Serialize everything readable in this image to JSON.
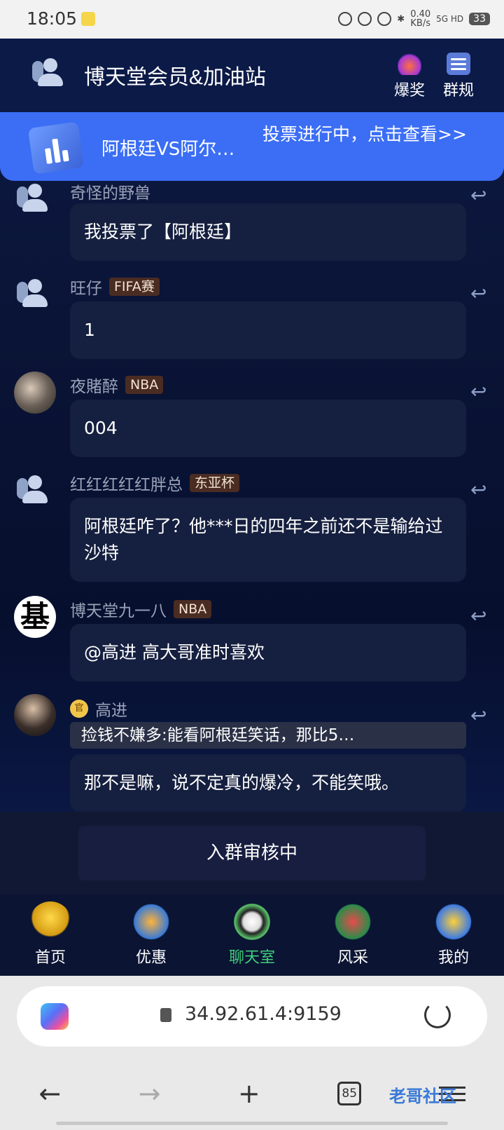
{
  "status_bar": {
    "time": "18:05",
    "speed_value": "0.40",
    "speed_unit": "KB/s",
    "network": "5G HD",
    "battery": "33"
  },
  "header": {
    "title": "博天堂会员&加油站",
    "prize_label": "爆奖",
    "rules_label": "群规"
  },
  "vote": {
    "title": "阿根廷VS阿尔…",
    "link": "投票进行中，点击查看>>"
  },
  "messages": [
    {
      "name": "奇怪的野兽",
      "badge": "",
      "text": "我投票了【阿根廷】"
    },
    {
      "name": "旺仔",
      "badge": "FIFA赛",
      "text": "1"
    },
    {
      "name": "夜賭醉",
      "badge": "NBA",
      "text": "004"
    },
    {
      "name": "红红红红红胖总",
      "badge": "东亚杯",
      "text": "阿根廷咋了？他***日的四年之前还不是输给过沙特"
    },
    {
      "name": "博天堂九一八",
      "badge": "NBA",
      "avatar_text": "基",
      "text": "@高进 高大哥准时喜欢"
    },
    {
      "name": "高进",
      "badge_icon": "官",
      "quote": "捡钱不嫌多:能看阿根廷笑话，那比5…",
      "text": "那不是嘛，说不定真的爆冷，不能笑哦。"
    }
  ],
  "join": {
    "label": "入群审核中"
  },
  "tabs": [
    {
      "label": "首页"
    },
    {
      "label": "优惠"
    },
    {
      "label": "聊天室",
      "active": true
    },
    {
      "label": "风采"
    },
    {
      "label": "我的"
    }
  ],
  "browser": {
    "url": "34.92.61.4:9159",
    "tab_count": "85"
  },
  "watermark": "老哥社区"
}
